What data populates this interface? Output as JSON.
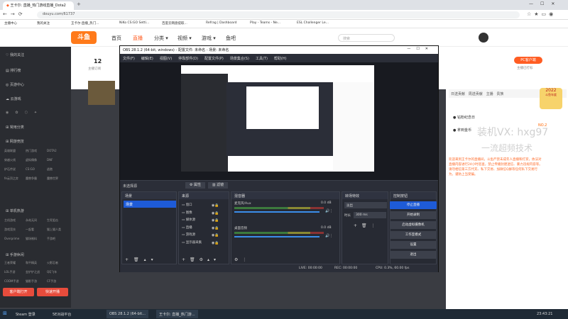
{
  "browser": {
    "tabs": [
      {
        "label": "王卡尔: 直播_热门游戏直播_Dota2",
        "active": true
      },
      {
        "label": "+",
        "active": false
      }
    ],
    "url": "douyu.com/61737",
    "bookmarks": [
      "主播中心",
      "我的关注",
      "王卡尔·直播_热门...",
      "NiKo CS:GO Setti...",
      "百度云网盘提取...",
      "Refrag | Dashboard",
      "Play - Teams - Ne...",
      "ESL Challenger Le..."
    ]
  },
  "douyu": {
    "logo": "斗鱼",
    "nav": [
      "首页",
      "直播",
      "分类 ▾",
      "视频 ▾",
      "游戏 ▾",
      "鱼吧"
    ],
    "search_placeholder": "搜索",
    "followers": "12",
    "followers_label": "主播订阅",
    "pc_button": "PC客户端",
    "pc_sub": "主播已打标",
    "sidebar": {
      "items": [
        "我的关注",
        "排行榜",
        "页游中心",
        "云游戏"
      ],
      "sections": [
        "常用分类",
        "网游竞技",
        "单机热游",
        "手游休闲"
      ],
      "grid_a": [
        "英雄联盟",
        "热门游戏",
        "DOTA2",
        "穿越火线",
        "虚拟偶像",
        "DNF",
        "炉石传说",
        "CS:GO",
        "逃跑",
        "fe云顶之弈",
        "魔兽争霸",
        "魔兽世界"
      ],
      "grid_b": [
        "主机游戏",
        "永劫无间",
        "生死狙击",
        "游戏竞技",
        "一起看",
        "猫上猫人类",
        "Overprime",
        "猫场制料",
        "手游吧"
      ],
      "grid_c": [
        "王者荣耀",
        "和平精英",
        "火影忍者",
        "LOL手游",
        "金铲铲之战",
        "QQ飞车",
        "CODM手游",
        "猫影手游",
        "CF手游"
      ],
      "btn_client": "客户端打开",
      "btn_record": "快速开播"
    },
    "right_panel": {
      "tabs": [
        "日送贡献",
        "周送贡献",
        "主播",
        "贵族"
      ],
      "badge": "2022",
      "badge_sub": "斗鱼年度",
      "fans1": "钻粉纪念日",
      "fans2": "拿到金币",
      "rank": "NO.2",
      "watermark": "装机VX: hxg97",
      "watermark2": "一流超频技术",
      "notice": "欢迎来到王卡尔的直播间，斗鱼严禁未成年人直播和打赏，依法对直播内容进行24小时巡查，禁止传播封建迷信、暴力违规内容等。请勿相信第三方代充、私下交易、加微信Q群等任何私下交易行为，谨防上当受骗。"
    }
  },
  "obs": {
    "title": "OBS 28.1.2 (64-bit, windows) - 配置文件: 未命名 - 场景: 未命名",
    "menu": [
      "文件(F)",
      "编辑(E)",
      "视图(V)",
      "停靠部件(D)",
      "配置文件(P)",
      "场景集合(S)",
      "工具(T)",
      "帮助(H)"
    ],
    "scene_label": "未选择源",
    "props_btn": "属性",
    "filter_btn": "滤镜",
    "docks": {
      "scenes": "场景",
      "sources": "来源",
      "mixer": "混音器",
      "transitions": "转场特效",
      "controls": "控制按钮"
    },
    "scene_items": [
      "场景"
    ],
    "source_items": [
      "窗口",
      "图像",
      "媒体源",
      "直播",
      "游戏源",
      "显示器采集"
    ],
    "mixer": [
      {
        "name": "麦克风/Aux",
        "db": "0.0 dB"
      },
      {
        "name": "桌面音频",
        "db": "0.0 dB"
      }
    ],
    "transition": {
      "type": "淡出",
      "duration_label": "时长",
      "duration": "300 ms"
    },
    "controls": [
      "停止直播",
      "开始录制",
      "启动虚拟摄像机",
      "工作室模式",
      "设置",
      "退出"
    ],
    "status": {
      "live": "LIVE: 00:00:00",
      "rec": "REC: 00:00:00",
      "cpu": "CPU: 0.3%, 60.00 fps"
    }
  },
  "taskbar": {
    "items": [
      "Steam 登录",
      "5E对战平台",
      "OBS 28.1.2 (64-bit...",
      "王卡尔: 直播_热门游..."
    ],
    "time": "23:43:21"
  }
}
